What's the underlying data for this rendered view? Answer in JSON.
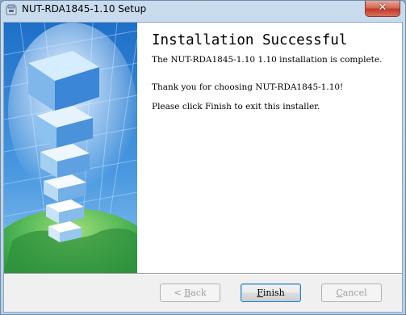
{
  "window": {
    "title": "NUT-RDA1845-1.10 Setup",
    "icon": "installer-icon",
    "close_label": "✕"
  },
  "content": {
    "heading": "Installation Successful",
    "line1": "The NUT-RDA1845-1.10 1.10 installation is complete.",
    "line2": "Thank you for choosing NUT-RDA1845-1.10!",
    "line3": "Please click Finish to exit this installer."
  },
  "buttons": {
    "back": {
      "prefix": "< ",
      "mnemonic": "B",
      "rest": "ack",
      "enabled": false
    },
    "finish": {
      "mnemonic": "F",
      "rest": "inish",
      "enabled": true,
      "default": true
    },
    "cancel": {
      "mnemonic": "C",
      "rest": "ancel",
      "enabled": false
    }
  },
  "colors": {
    "banner_sky": "#2f7fd0",
    "globe_green": "#3aa84a"
  }
}
